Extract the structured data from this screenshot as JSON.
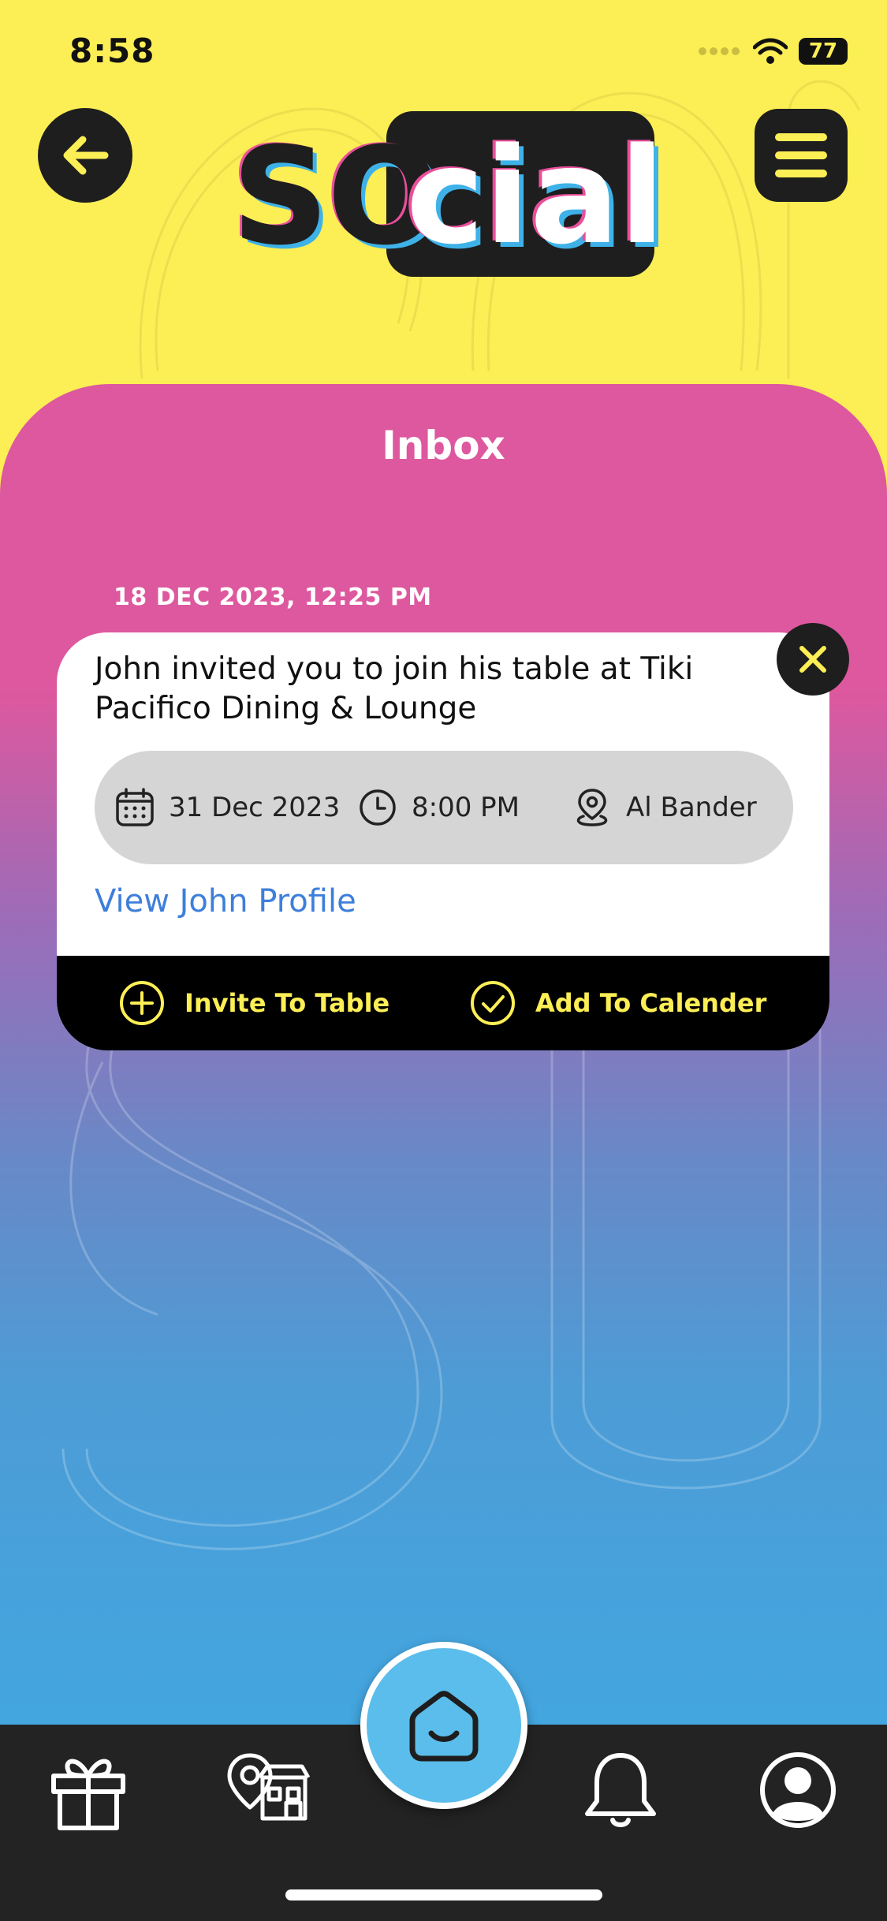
{
  "status_bar": {
    "time": "8:58",
    "battery": "77"
  },
  "header": {
    "logo_text": "social"
  },
  "inbox": {
    "title": "Inbox",
    "messages": [
      {
        "timestamp": "18 DEC 2023, 12:25 PM",
        "text": "John invited you to join his table at Tiki Pacifico Dining & Lounge",
        "date": "31 Dec 2023",
        "time": "8:00 PM",
        "location": "Al Bander",
        "profile_link": "View John Profile",
        "invite_label": "Invite To Table",
        "calendar_label": "Add To Calender"
      }
    ]
  },
  "bottom_nav": {
    "items": [
      {
        "icon": "gift-icon"
      },
      {
        "icon": "location-store-icon"
      },
      {
        "icon": "home-icon"
      },
      {
        "icon": "bell-icon"
      },
      {
        "icon": "profile-icon"
      }
    ]
  },
  "colors": {
    "yellow": "#FCEE55",
    "pink": "#DD589E",
    "blue": "#43A6DF",
    "dark": "#1E1E1E",
    "link": "#3D7FDA"
  }
}
